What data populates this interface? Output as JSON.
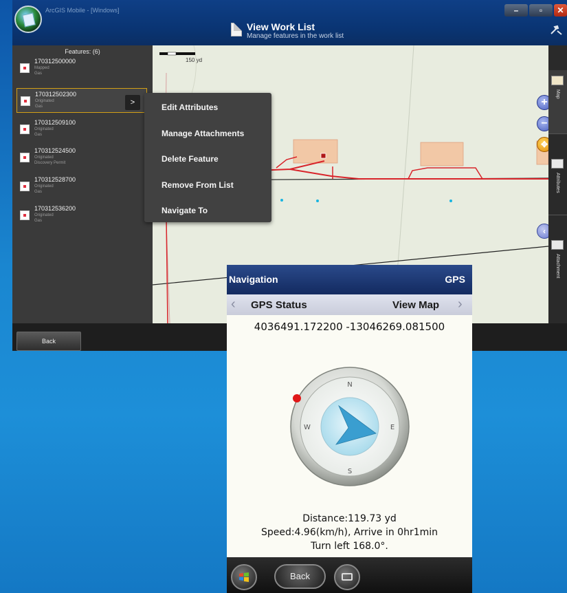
{
  "app": {
    "name": "ArcGIS Mobile - [Windows]",
    "header_title": "View Work List",
    "header_subtitle": "Manage features in the work list",
    "window_buttons": {
      "minimize": "–",
      "maximize": "▫",
      "close": "✕"
    }
  },
  "features_panel": {
    "header": "Features: (6)",
    "items": [
      {
        "id": "170312500000",
        "status": "Mapped",
        "type": "Gas"
      },
      {
        "id": "170312502300",
        "status": "Originated",
        "type": "Gas"
      },
      {
        "id": "170312509100",
        "status": "Originated",
        "type": "Gas"
      },
      {
        "id": "170312524500",
        "status": "Originated",
        "type": "Discovery Permit"
      },
      {
        "id": "170312528700",
        "status": "Originated",
        "type": "Gas"
      },
      {
        "id": "170312536200",
        "status": "Originated",
        "type": "Gas"
      }
    ],
    "selected_index": 1,
    "arrow_label": ">"
  },
  "map": {
    "scale_label": "150 yd",
    "zoom_in": "+",
    "zoom_out": "–",
    "pan": "✥",
    "back": "‹"
  },
  "side_tabs": {
    "map": "Map",
    "attributes": "Attributes",
    "attachment": "Attachment"
  },
  "context_menu": {
    "items": [
      "Edit Attributes",
      "Manage Attachments",
      "Delete Feature",
      "Remove From List",
      "Navigate To"
    ]
  },
  "bottom_bar": {
    "back_label": "Back"
  },
  "mobile": {
    "title": "Navigation",
    "gps_label": "GPS",
    "prev_chevron": "‹",
    "next_chevron": "›",
    "gps_status_label": "GPS Status",
    "view_map_label": "View Map",
    "coordinates": "4036491.172200 -13046269.081500",
    "compass_letters": {
      "n": "N",
      "e": "E",
      "s": "S",
      "w": "W"
    },
    "distance": "Distance:119.73 yd",
    "speed": "Speed:4.96(km/h), Arrive in 0hr1min",
    "turn": "Turn left 168.0°.",
    "back_label": "Back"
  },
  "colors": {
    "desktop_background": "#1a86d0",
    "title_bar": "#0a3574",
    "selection_border": "#d4a016",
    "road_red": "#d8242a",
    "parcel_fill": "#f2c8a6",
    "waypoint_cyan": "#18b4e0",
    "compass_arrow": "#3a9ed0",
    "target_dot": "#e01818"
  }
}
